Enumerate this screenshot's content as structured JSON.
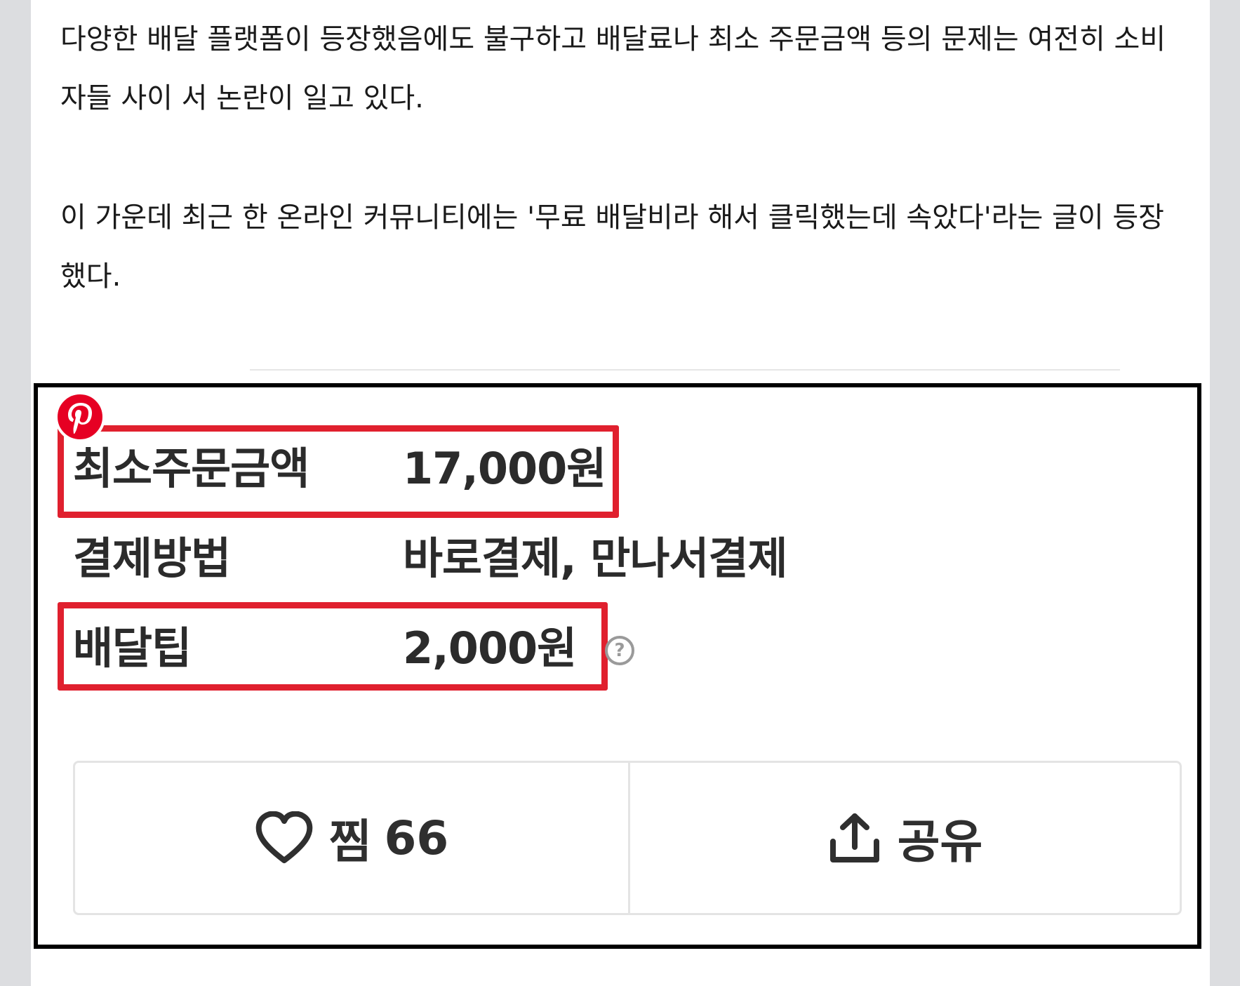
{
  "article": {
    "paragraph1": "다양한 배달 플랫폼이 등장했음에도 불구하고 배달료나 최소 주문금액 등의 문제는 여전히 소비자들 사이 서 논란이 일고 있다.",
    "paragraph2": "이 가운데 최근 한 온라인 커뮤니티에는 '무료 배달비라 해서 클릭했는데 속았다'라는 글이 등장했다."
  },
  "screenshot": {
    "rows": [
      {
        "label": "최소주문금액",
        "value": "17,000원",
        "highlighted": true
      },
      {
        "label": "결제방법",
        "value": "바로결제, 만나서결제",
        "highlighted": false
      },
      {
        "label": "배달팁",
        "value": "2,000원",
        "highlighted": true
      }
    ],
    "help_glyph": "?",
    "like": {
      "label": "찜",
      "count": "66"
    },
    "share": {
      "label": "공유"
    }
  },
  "colors": {
    "highlight": "#e0202e",
    "pinterest": "#e60023",
    "frame": "#000000",
    "background": "#dcdde0"
  },
  "icons": [
    "pinterest-icon",
    "help-icon",
    "heart-icon",
    "share-icon"
  ]
}
